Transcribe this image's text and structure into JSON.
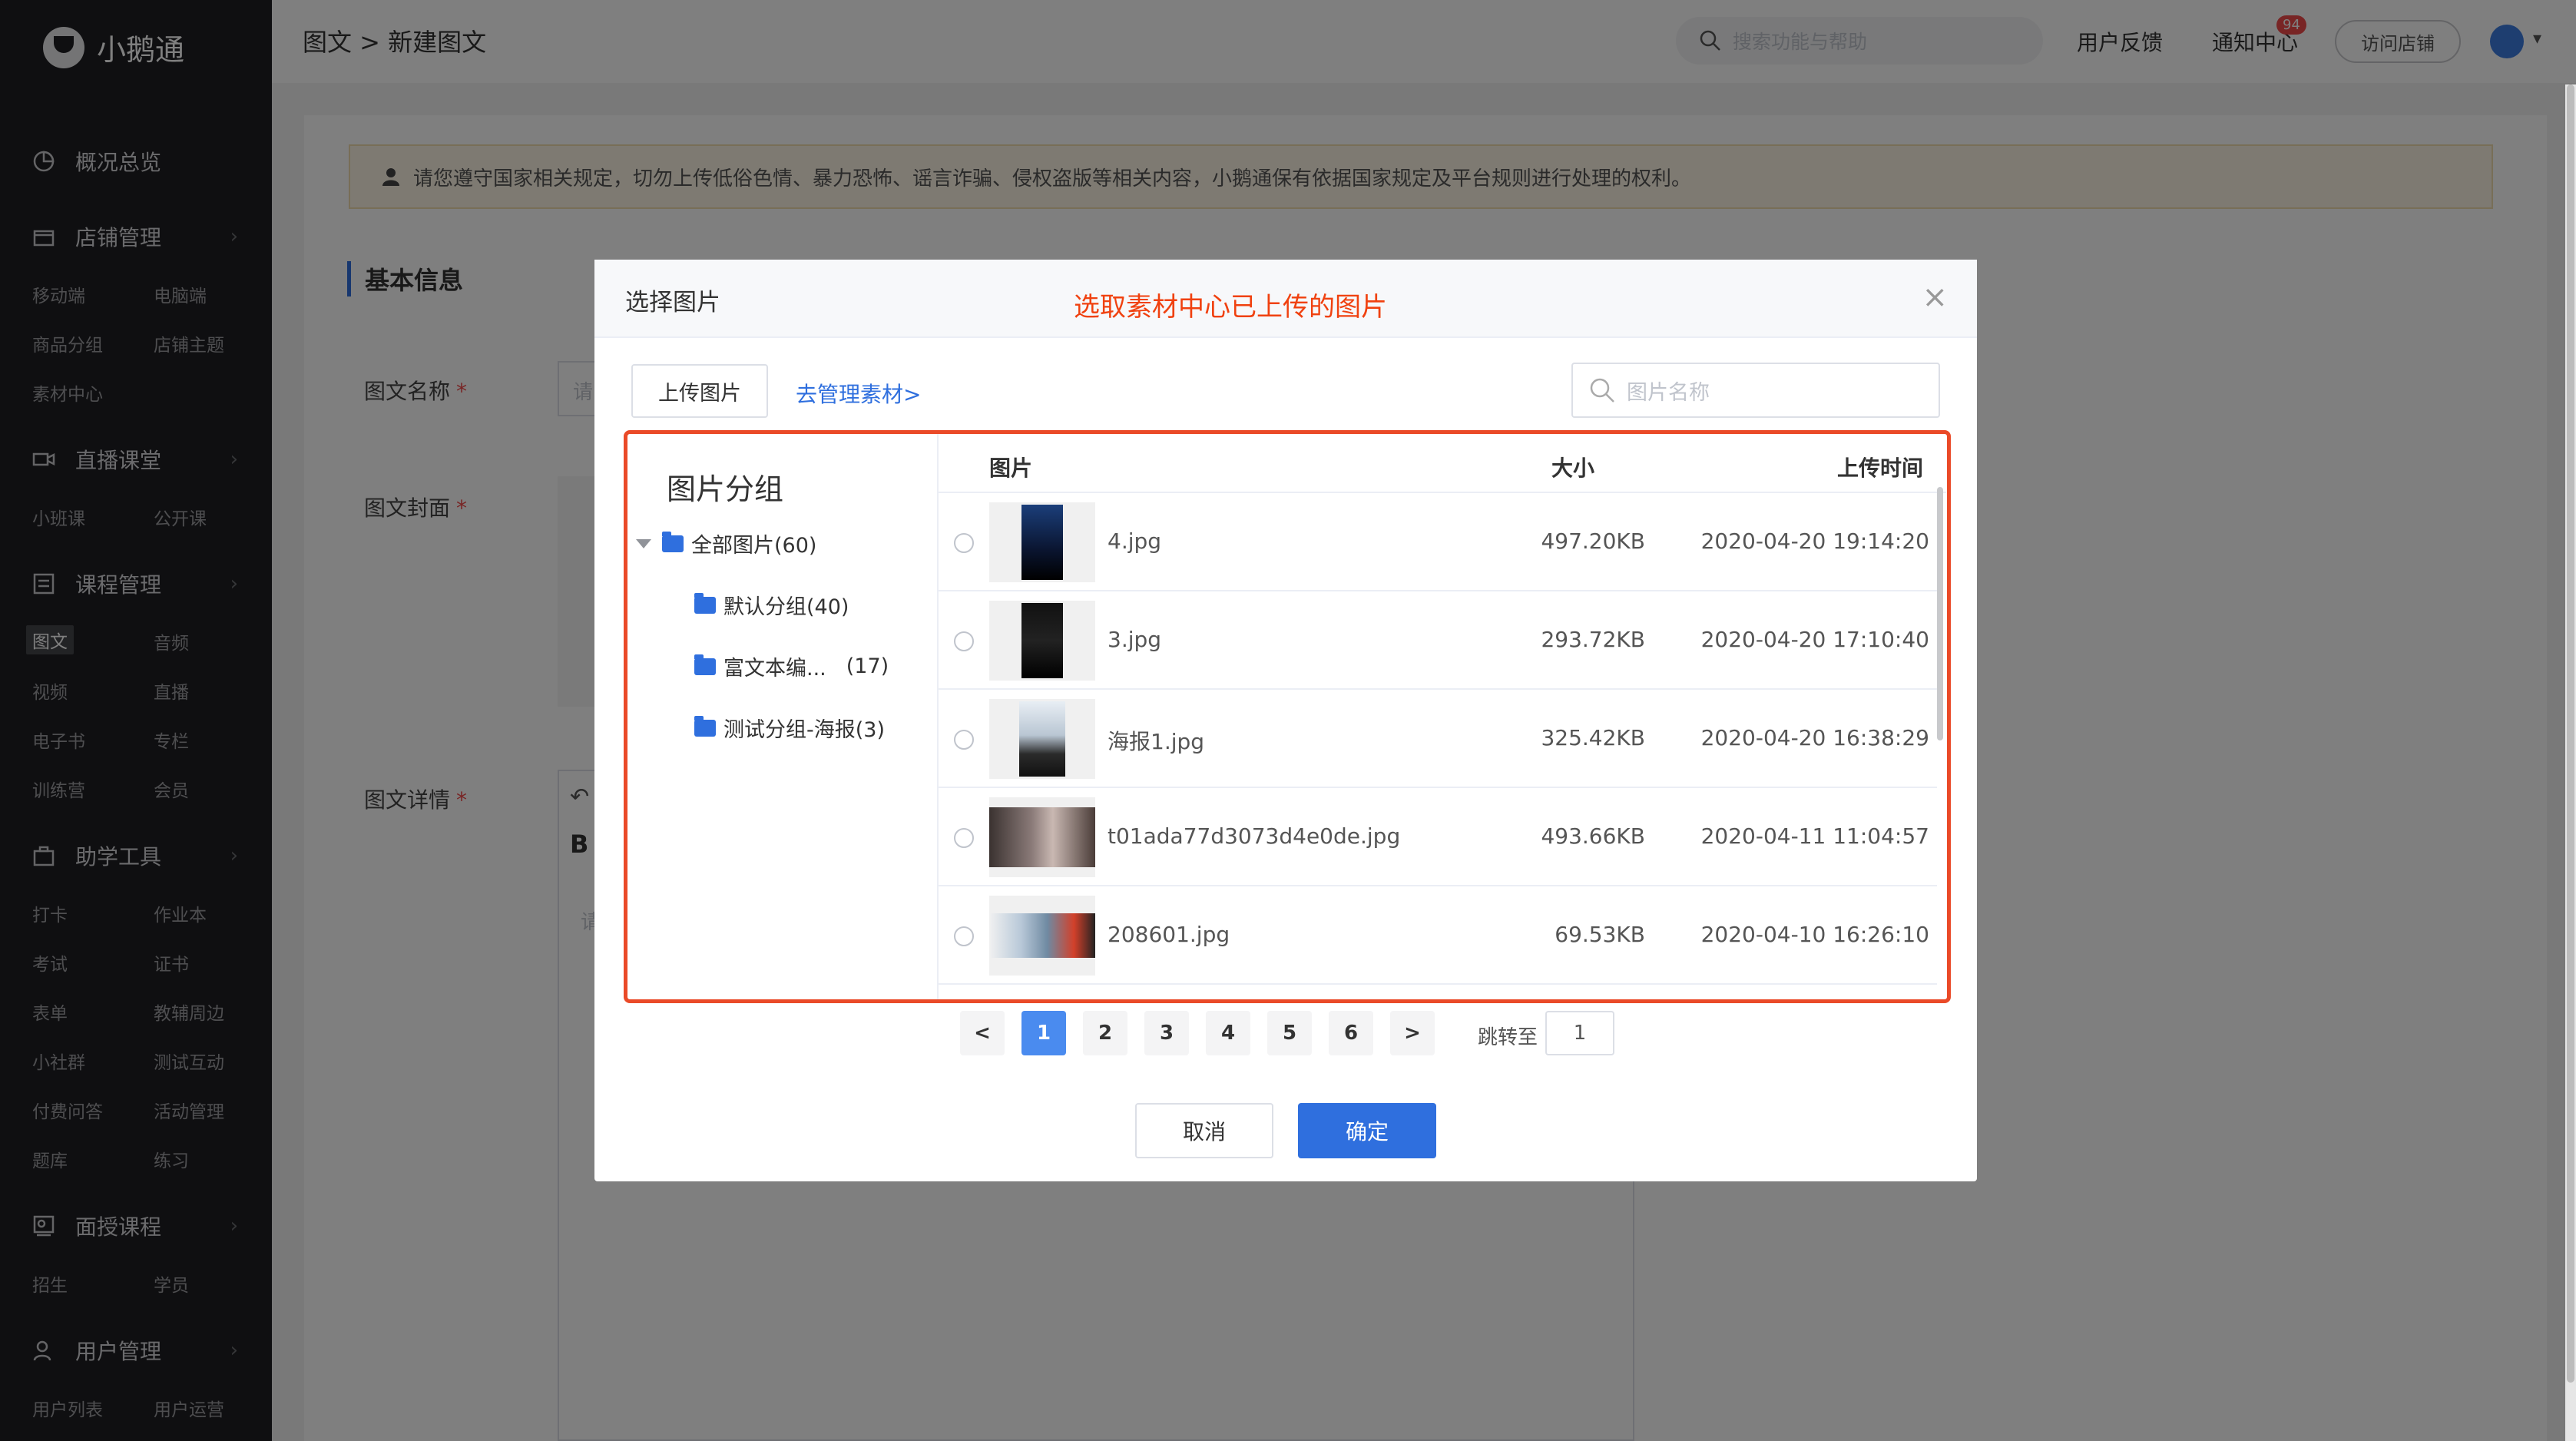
{
  "app": {
    "name": "小鹅通"
  },
  "sidebar": {
    "sections": [
      {
        "label": "概况总览",
        "icon": "dashboard-icon",
        "has_chevron": false
      },
      {
        "label": "店铺管理",
        "icon": "store-icon",
        "has_chevron": true
      },
      {
        "label": "直播课堂",
        "icon": "video-camera-icon",
        "has_chevron": true
      },
      {
        "label": "课程管理",
        "icon": "course-list-icon",
        "has_chevron": true
      },
      {
        "label": "助学工具",
        "icon": "toolbox-icon",
        "has_chevron": true
      },
      {
        "label": "面授课程",
        "icon": "classroom-icon",
        "has_chevron": true
      },
      {
        "label": "用户管理",
        "icon": "user-icon",
        "has_chevron": true
      }
    ],
    "subitems": {
      "store": [
        "移动端",
        "电脑端",
        "商品分组",
        "店铺主题",
        "素材中心"
      ],
      "live": [
        "小班课",
        "公开课"
      ],
      "course": [
        "图文",
        "音频",
        "视频",
        "直播",
        "电子书",
        "专栏",
        "训练营",
        "会员"
      ],
      "tools": [
        "打卡",
        "作业本",
        "考试",
        "证书",
        "表单",
        "教辅周边",
        "小社群",
        "测试互动",
        "付费问答",
        "活动管理",
        "题库",
        "练习"
      ],
      "offline": [
        "招生",
        "学员"
      ],
      "users": [
        "用户列表",
        "用户运营"
      ]
    },
    "active_subitem": "图文"
  },
  "topbar": {
    "breadcrumb": "图文 > 新建图文",
    "search_placeholder": "搜索功能与帮助",
    "feedback": "用户反馈",
    "notifications": "通知中心",
    "notification_count": "94",
    "visit_store": "访问店铺"
  },
  "page": {
    "notice": "请您遵守国家相关规定，切勿上传低俗色情、暴力恐怖、谣言诈骗、侵权盗版等相关内容，小鹅通保有依据国家规定及平台规则进行处理的权利。",
    "section_title": "基本信息",
    "labels": {
      "name": "图文名称",
      "cover": "图文封面",
      "detail": "图文详情"
    },
    "required_mark": "*",
    "name_placeholder_fragment": "请",
    "detail_placeholder_fragment": "请",
    "editor_bold": "B"
  },
  "dialog": {
    "title": "选择图片",
    "annotation": "选取素材中心已上传的图片",
    "upload_button": "上传图片",
    "manage_link": "去管理素材>",
    "search_placeholder": "图片名称",
    "groups_title": "图片分组",
    "groups": [
      {
        "label": "全部图片(60)",
        "level": 0
      },
      {
        "label": "默认分组(40)",
        "level": 1
      },
      {
        "label": "富文本编...",
        "count": "(17)",
        "level": 1
      },
      {
        "label": "测试分组-海报(3)",
        "level": 1
      }
    ],
    "columns": {
      "image": "图片",
      "size": "大小",
      "time": "上传时间"
    },
    "rows": [
      {
        "name": "4.jpg",
        "size": "497.20KB",
        "time": "2020-04-20 19:14:20"
      },
      {
        "name": "3.jpg",
        "size": "293.72KB",
        "time": "2020-04-20 17:10:40"
      },
      {
        "name": "海报1.jpg",
        "size": "325.42KB",
        "time": "2020-04-20 16:38:29"
      },
      {
        "name": "t01ada77d3073d4e0de.jpg",
        "size": "493.66KB",
        "time": "2020-04-11 11:04:57"
      },
      {
        "name": "208601.jpg",
        "size": "69.53KB",
        "time": "2020-04-10 16:26:10"
      }
    ],
    "pagination": {
      "pages": [
        "1",
        "2",
        "3",
        "4",
        "5",
        "6"
      ],
      "current": "1",
      "prev": "<",
      "next": ">",
      "jump_label": "跳转至",
      "jump_value": "1"
    },
    "cancel": "取消",
    "confirm": "确定"
  },
  "colors": {
    "accent": "#2f6fde",
    "annotation": "#f0410f",
    "sidebar_bg": "#1f1f23"
  }
}
